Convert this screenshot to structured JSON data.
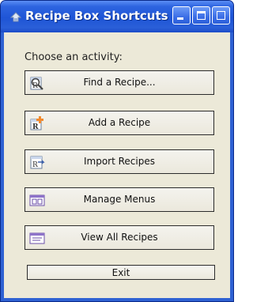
{
  "window": {
    "title": "Recipe Box Shortcuts",
    "title_icon": "recipe-box-app-icon",
    "controls": {
      "minimize": "minimize-icon",
      "maximize": "maximize-icon",
      "close": "close-icon"
    }
  },
  "prompt": "Choose an activity:",
  "actions": [
    {
      "label": "Find a Recipe...",
      "icon": "find-recipe-icon"
    },
    {
      "label": "Add a Recipe",
      "icon": "add-recipe-icon"
    },
    {
      "label": "Import Recipes",
      "icon": "import-recipes-icon"
    },
    {
      "label": "Manage Menus",
      "icon": "manage-menus-icon"
    },
    {
      "label": "View All Recipes",
      "icon": "view-all-recipes-icon"
    }
  ],
  "exit_label": "Exit",
  "colors": {
    "titlebar": "#245edc",
    "client_bg": "#ece9d8",
    "button_border": "#2b2b2b"
  }
}
